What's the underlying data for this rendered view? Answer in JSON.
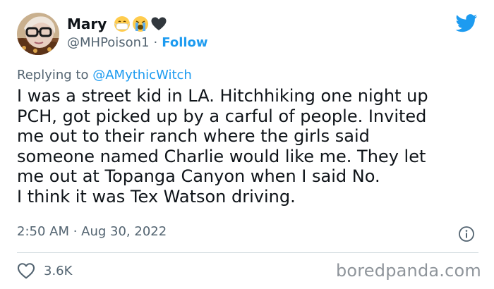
{
  "author": {
    "name": "Mary",
    "handle": "@MHPoison1",
    "separator": "·",
    "follow_label": "Follow"
  },
  "reply": {
    "prefix": "Replying to",
    "target": "@AMythicWitch"
  },
  "tweet": {
    "lines": [
      "I was a street kid in LA. Hitchhiking one night up",
      "PCH, got picked up by a carful of people. Invited",
      "me out to their ranch where the girls said",
      "someone named Charlie would like me. They let",
      "me out at Topanga Canyon when I said No.",
      "I think it was Tex Watson driving."
    ],
    "timestamp": "2:50 AM · Aug 30, 2022",
    "like_count": "3.6K"
  },
  "watermark": "boredpanda.com",
  "icons": {
    "logo": "twitter-bird-icon",
    "info": "info-icon",
    "like": "heart-icon",
    "name_emojis": [
      "mask-face-emoji",
      "crying-face-emoji",
      "black-heart-emoji"
    ]
  },
  "colors": {
    "accent": "#1d9bf0",
    "text": "#0f1419",
    "secondary": "#536471",
    "divider": "#cfd9de"
  }
}
